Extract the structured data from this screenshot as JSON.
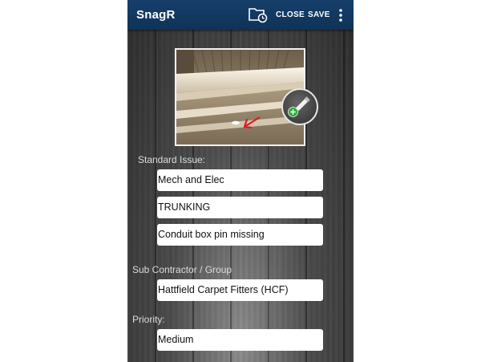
{
  "app": {
    "title": "SnagR"
  },
  "toolbar": {
    "close_label": "CLOSE",
    "save_label": "SAVE"
  },
  "icons": {
    "folder": "folder-clock-icon",
    "overflow": "more-vert-icon",
    "edit": "pencil-add-icon",
    "add_badge": "plus-circle-icon"
  },
  "colors": {
    "appbar": "#15395f",
    "field_background": "#ffffff",
    "label_text": "#dcdcdc",
    "badge_green": "#2cab37",
    "annotation_red": "#d81e1e"
  },
  "form": {
    "standard_issue": {
      "label": "Standard Issue:",
      "category": "Mech and Elec",
      "item": "TRUNKING",
      "description": "Conduit box pin missing"
    },
    "sub_contractor": {
      "label": "Sub Contractor / Group",
      "value": "Hattfield Carpet Fitters (HCF)"
    },
    "priority": {
      "label": "Priority:",
      "value": "Medium"
    }
  }
}
